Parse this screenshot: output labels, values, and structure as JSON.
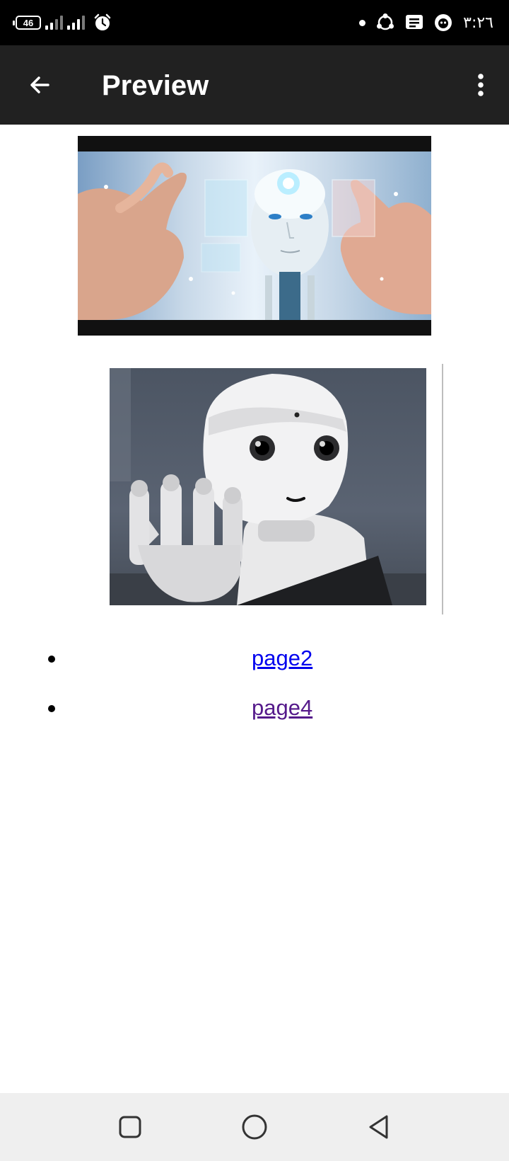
{
  "status_bar": {
    "battery_level": "46",
    "time": "٣:٢٦",
    "icons": [
      "battery-icon",
      "signal-icon",
      "signal-icon",
      "alarm-icon",
      "notification-dot-icon",
      "sync-icon",
      "message-icon",
      "assistant-icon"
    ]
  },
  "app_bar": {
    "title": "Preview",
    "back_icon": "arrow-back-icon",
    "menu_icon": "more-vertical-icon"
  },
  "content": {
    "images": [
      {
        "name": "ai-head-hologram-image"
      },
      {
        "name": "pepper-robot-image"
      }
    ],
    "links": [
      {
        "label": "page2",
        "visited": false
      },
      {
        "label": "page4",
        "visited": true
      }
    ]
  },
  "nav_bar": {
    "icons": [
      "recent-apps-icon",
      "home-icon",
      "back-icon"
    ]
  },
  "colors": {
    "status_bar": "#000000",
    "app_bar": "#212121",
    "link": "#0000ee",
    "visited_link": "#551a8b",
    "nav_bar": "#efefef"
  }
}
